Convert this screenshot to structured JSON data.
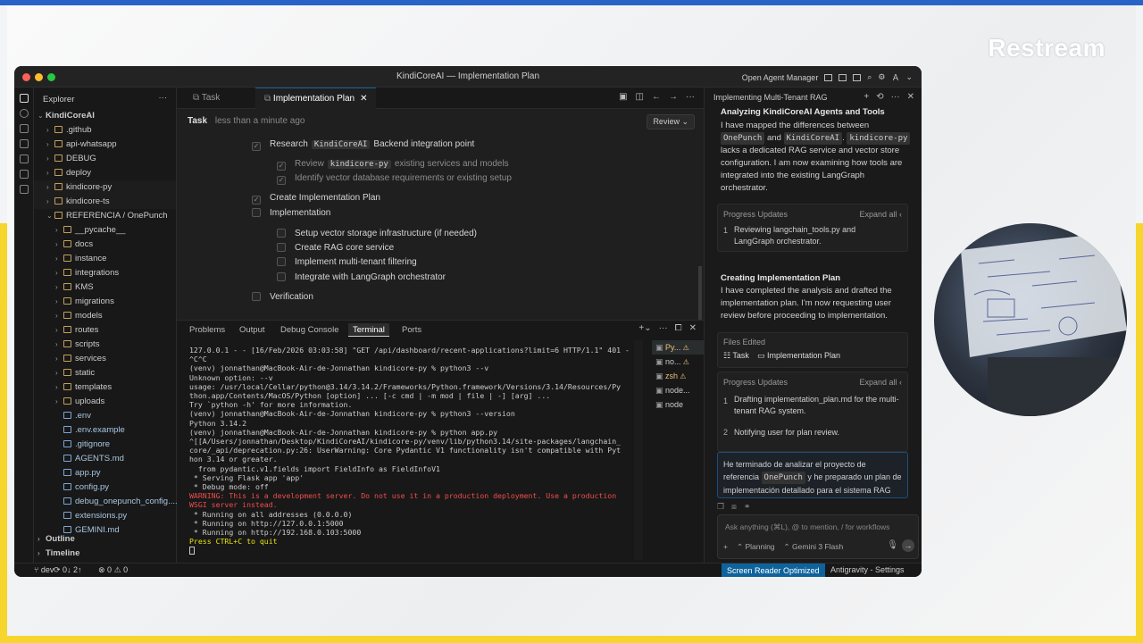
{
  "overlay": {
    "brand": "Restream"
  },
  "window": {
    "title": "KindiCoreAI — Implementation Plan",
    "agent_manager": "Open Agent Manager"
  },
  "explorer": {
    "header": "Explorer",
    "root": "KindiCoreAI",
    "items": [
      {
        "label": ".github",
        "indent": 1,
        "type": "folder"
      },
      {
        "label": "api-whatsapp",
        "indent": 1,
        "type": "folder"
      },
      {
        "label": "DEBUG",
        "indent": 1,
        "type": "folder"
      },
      {
        "label": "deploy",
        "indent": 1,
        "type": "folder"
      },
      {
        "label": "kindicore-py",
        "indent": 1,
        "type": "folder"
      },
      {
        "label": "kindicore-ts",
        "indent": 1,
        "type": "folder"
      },
      {
        "label": "REFERENCIA / OnePunch",
        "indent": 1,
        "type": "folder-open"
      },
      {
        "label": "__pycache__",
        "indent": 2,
        "type": "folder"
      },
      {
        "label": "docs",
        "indent": 2,
        "type": "folder"
      },
      {
        "label": "instance",
        "indent": 2,
        "type": "folder"
      },
      {
        "label": "integrations",
        "indent": 2,
        "type": "folder"
      },
      {
        "label": "KMS",
        "indent": 2,
        "type": "folder"
      },
      {
        "label": "migrations",
        "indent": 2,
        "type": "folder"
      },
      {
        "label": "models",
        "indent": 2,
        "type": "folder"
      },
      {
        "label": "routes",
        "indent": 2,
        "type": "folder"
      },
      {
        "label": "scripts",
        "indent": 2,
        "type": "folder"
      },
      {
        "label": "services",
        "indent": 2,
        "type": "folder"
      },
      {
        "label": "static",
        "indent": 2,
        "type": "folder"
      },
      {
        "label": "templates",
        "indent": 2,
        "type": "folder"
      },
      {
        "label": "uploads",
        "indent": 2,
        "type": "folder"
      },
      {
        "label": ".env",
        "indent": 2,
        "type": "file"
      },
      {
        "label": ".env.example",
        "indent": 2,
        "type": "file"
      },
      {
        "label": ".gitignore",
        "indent": 2,
        "type": "file"
      },
      {
        "label": "AGENTS.md",
        "indent": 2,
        "type": "file"
      },
      {
        "label": "app.py",
        "indent": 2,
        "type": "file"
      },
      {
        "label": "config.py",
        "indent": 2,
        "type": "file"
      },
      {
        "label": "debug_onepunch_config....",
        "indent": 2,
        "type": "file"
      },
      {
        "label": "extensions.py",
        "indent": 2,
        "type": "file"
      },
      {
        "label": "GEMINI.md",
        "indent": 2,
        "type": "file"
      }
    ],
    "outline": "Outline",
    "timeline": "Timeline"
  },
  "editor": {
    "tabs": [
      "Task",
      "Implementation Plan"
    ],
    "task_label": "Task",
    "task_time": "less than a minute ago",
    "review": "Review",
    "plan": [
      {
        "text": "Research",
        "code": "KindiCoreAI",
        "rest": "Backend integration point",
        "level": 0,
        "checked": true
      },
      {
        "text": "Review",
        "code": "kindicore-py",
        "rest": "existing services and models",
        "level": 1,
        "checked": true
      },
      {
        "text": "Identify vector database requirements or existing setup",
        "code": "",
        "rest": "",
        "level": 1,
        "checked": true
      },
      {
        "text": "Create Implementation Plan",
        "code": "",
        "rest": "",
        "level": 0,
        "checked": true
      },
      {
        "text": "Implementation",
        "code": "",
        "rest": "",
        "level": 0,
        "checked": false
      },
      {
        "text": "Setup vector storage infrastructure (if needed)",
        "code": "",
        "rest": "",
        "level": 1,
        "checked": false
      },
      {
        "text": "Create RAG core service",
        "code": "",
        "rest": "",
        "level": 1,
        "checked": false
      },
      {
        "text": "Implement multi-tenant filtering",
        "code": "",
        "rest": "",
        "level": 1,
        "checked": false
      },
      {
        "text": "Integrate with LangGraph orchestrator",
        "code": "",
        "rest": "",
        "level": 1,
        "checked": false
      },
      {
        "text": "Verification",
        "code": "",
        "rest": "",
        "level": 0,
        "checked": false
      }
    ]
  },
  "terminal": {
    "tabs": [
      "Problems",
      "Output",
      "Debug Console",
      "Terminal",
      "Ports"
    ],
    "lines": [
      "127.0.0.1 - - [16/Feb/2026 03:03:58] \"GET /api/dashboard/recent-applications?limit=6 HTTP/1.1\" 401 -",
      "^C^C",
      "(venv) jonnathan@MacBook-Air-de-Jonnathan kindicore-py % python3 --v",
      "Unknown option: --v",
      "usage: /usr/local/Cellar/python@3.14/3.14.2/Frameworks/Python.framework/Versions/3.14/Resources/Py",
      "thon.app/Contents/MacOS/Python [option] ... [-c cmd | -m mod | file | -] [arg] ...",
      "Try `python -h' for more information.",
      "(venv) jonnathan@MacBook-Air-de-Jonnathan kindicore-py % python3 --version",
      "Python 3.14.2",
      "(venv) jonnathan@MacBook-Air-de-Jonnathan kindicore-py % python app.py",
      "^[[A/Users/jonnathan/Desktop/KindiCoreAI/kindicore-py/venv/lib/python3.14/site-packages/langchain_",
      "core/_api/deprecation.py:26: UserWarning: Core Pydantic V1 functionality isn't compatible with Pyt",
      "hon 3.14 or greater.",
      "  from pydantic.v1.fields import FieldInfo as FieldInfoV1",
      " * Serving Flask app 'app'",
      " * Debug mode: off",
      "WARNING: This is a development server. Do not use it in a production deployment. Use a production",
      "WSGI server instead.",
      " * Running on all addresses (0.0.0.0)",
      " * Running on http://127.0.0.1:5000",
      " * Running on http://192.168.0.103:5000",
      "Press CTRL+C to quit"
    ],
    "sessions": [
      "Py...",
      "no...",
      "zsh",
      "node...",
      "node"
    ]
  },
  "agent": {
    "header": "Implementing Multi-Tenant RAG",
    "section1_title": "Analyzing KindiCoreAI Agents and Tools",
    "section1_body_a": "I have mapped the differences between",
    "section1_code1": "OnePunch",
    "section1_body_b": "and",
    "section1_code2": "KindiCoreAI",
    "section1_code3": "kindicore-py",
    "section1_body_c": "lacks a dedicated RAG service and vector store configuration. I am now examining how tools are integrated into the existing LangGraph orchestrator.",
    "progress_label": "Progress Updates",
    "expand_all": "Expand all",
    "progress1": [
      {
        "n": "1",
        "text": "Reviewing langchain_tools.py and LangGraph orchestrator."
      }
    ],
    "section2_title": "Creating Implementation Plan",
    "section2_body": "I have completed the analysis and drafted the implementation plan. I'm now requesting user review before proceeding to implementation.",
    "files_edited": "Files Edited",
    "file1": "Task",
    "file2": "Implementation Plan",
    "progress2": [
      {
        "n": "1",
        "text": "Drafting implementation_plan.md for the multi-tenant RAG system."
      },
      {
        "n": "2",
        "text": "Notifying user for plan review."
      }
    ],
    "user_msg_a": "He terminado de analizar el proyecto de referencia",
    "user_msg_code": "OnePunch",
    "user_msg_b": "y he preparado un plan de implementación detallado para el sistema RAG",
    "input_placeholder": "Ask anything (⌘L), @ to mention, / for workflows",
    "mode": "Planning",
    "model": "Gemini 3 Flash"
  },
  "statusbar": {
    "branch": "dev",
    "sync": "0↓ 2↑",
    "errors": "0",
    "warnings": "0",
    "screen_reader": "Screen Reader Optimized",
    "settings": "Antigravity - Settings"
  },
  "colors": {
    "accent": "#0e639c",
    "warning": "#f14c4c",
    "green": "#23d18b"
  }
}
